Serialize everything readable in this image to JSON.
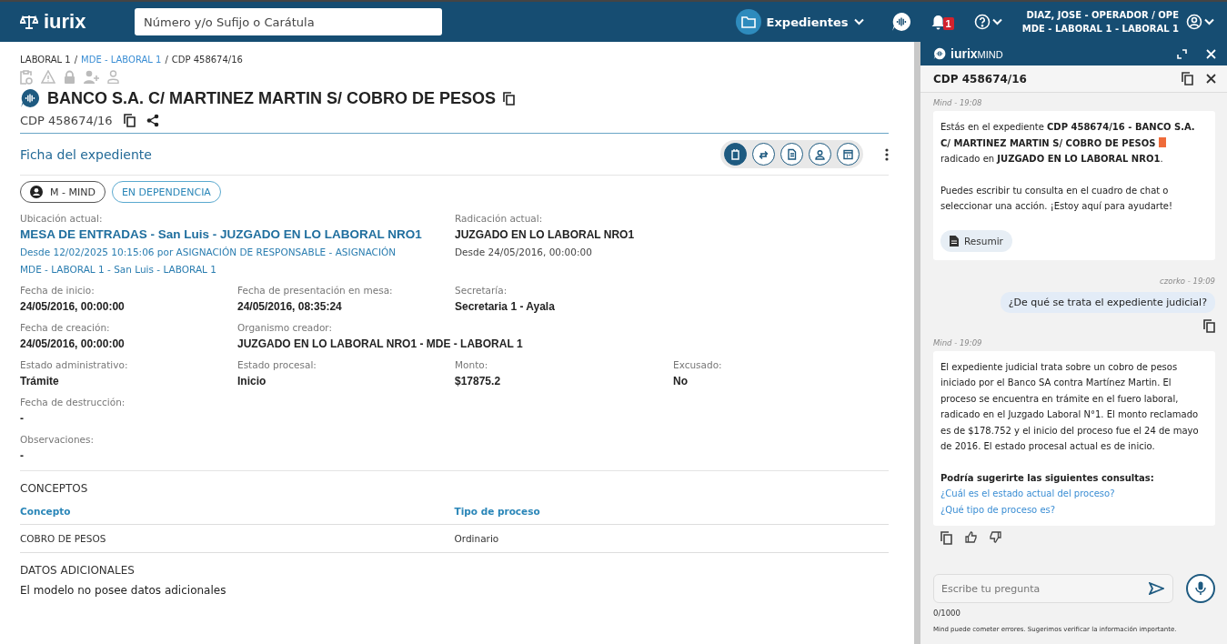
{
  "topbar": {
    "brand": "iurix",
    "search": {
      "placeholder": "Número y/o Sufijo o Carátula"
    },
    "module": "Expedientes",
    "notifications": "1",
    "user": {
      "line1": "DIAZ, JOSE - OPERADOR / OPE",
      "line2": "MDE - LABORAL 1 - LABORAL 1"
    }
  },
  "breadcrumb": [
    {
      "label": "LABORAL 1",
      "link": false
    },
    {
      "label": "MDE - LABORAL 1",
      "link": true
    },
    {
      "label": "CDP 458674/16",
      "link": false
    }
  ],
  "breadcrumb_separator": "/",
  "case": {
    "title": "BANCO S.A. C/ MARTINEZ MARTIN S/ COBRO DE PESOS",
    "number": "CDP 458674/16"
  },
  "section": {
    "title": "Ficha del expediente",
    "actions": [
      {
        "selected": true
      },
      {
        "selected": false
      },
      {
        "selected": false
      },
      {
        "selected": false
      },
      {
        "selected": false
      }
    ]
  },
  "chips": [
    {
      "label": "M - MIND",
      "kind": "person"
    },
    {
      "label": "EN DEPENDENCIA",
      "kind": "status"
    }
  ],
  "location": {
    "label": "Ubicación actual:",
    "value": "MESA DE ENTRADAS - San Luis - JUZGADO EN LO LABORAL NRO1",
    "details": [
      "Desde 12/02/2025 10:15:06 por ASIGNACIÓN DE RESPONSABLE - ASIGNACIÓN",
      "MDE - LABORAL 1 - San Luis - LABORAL 1"
    ]
  },
  "filing": {
    "label": "Radicación actual:",
    "value": "JUZGADO EN LO LABORAL NRO1",
    "detail": "Desde 24/05/2016, 00:00:00"
  },
  "field_rows": [
    [
      {
        "label": "Fecha de inicio:",
        "value": "24/05/2016, 00:00:00"
      },
      {
        "label": "Fecha de presentación en mesa:",
        "value": "24/05/2016, 08:35:24"
      },
      {
        "label": "Secretaría:",
        "value": "Secretaria 1 - Ayala"
      }
    ],
    [
      {
        "label": "Fecha de creación:",
        "value": "24/05/2016, 00:00:00"
      },
      {
        "label": "Organismo creador:",
        "value": "JUZGADO EN LO LABORAL NRO1 - MDE - LABORAL 1"
      }
    ],
    [
      {
        "label": "Estado administrativo:",
        "value": "Trámite"
      },
      {
        "label": "Estado procesal:",
        "value": "Inicio"
      },
      {
        "label": "Monto:",
        "value": "$17875.2"
      },
      {
        "label": "Excusado:",
        "value": "No"
      }
    ],
    [
      {
        "label": "Fecha de destrucción:",
        "value": "-"
      }
    ],
    [
      {
        "label": "Observaciones:",
        "value": "-"
      }
    ]
  ],
  "concepts": {
    "title": "CONCEPTOS",
    "columns": [
      "Concepto",
      "Tipo de proceso"
    ],
    "rows": [
      [
        "COBRO DE PESOS",
        "Ordinario"
      ]
    ]
  },
  "additional": {
    "title": "DATOS ADICIONALES",
    "text": "El modelo no posee datos adicionales"
  },
  "assistant": {
    "brand": "iurix",
    "brand_suffix": "MIND",
    "case_number": "CDP 458674/16",
    "messages": [
      {
        "kind": "bot",
        "meta": "Mind - 19:08",
        "lead": {
          "before": "Estás en el expediente **CDP 458674/16 - BANCO S.A. C/ MARTINEZ MARTIN S/ COBRO DE PESOS**",
          "after": "radicado en **JUZGADO EN LO LABORAL NRO1**."
        },
        "paragraphs": [
          "Puedes escribir tu consulta en el cuadro de chat o seleccionar una acción. ¡Estoy aquí para ayudarte!"
        ],
        "action": "Resumir"
      },
      {
        "kind": "user",
        "meta": "czorko - 19:09",
        "text": "¿De qué se trata el expediente judicial?"
      },
      {
        "kind": "bot",
        "meta": "Mind - 19:09",
        "paragraphs": [
          "El expediente judicial trata sobre un cobro de pesos iniciado por el Banco SA contra Martínez Martin. El proceso se encuentra en trámite en el fuero laboral, radicado en el Juzgado Laboral N°1. El monto reclamado es de $178.752 y el inicio del proceso fue el 24 de mayo de 2016. El estado procesal actual es de inicio."
        ],
        "suggest_title": "Podría sugerirte las siguientes consultas:",
        "suggestions": [
          "¿Cuál es el estado actual del proceso?",
          "¿Qué tipo de proceso es?"
        ],
        "feedback": true
      }
    ],
    "input": {
      "placeholder": "Escribe tu pregunta",
      "counter": "0/1000"
    },
    "disclaimer": "Mind puede cometer errores. Sugerimos verificar la información importante."
  }
}
